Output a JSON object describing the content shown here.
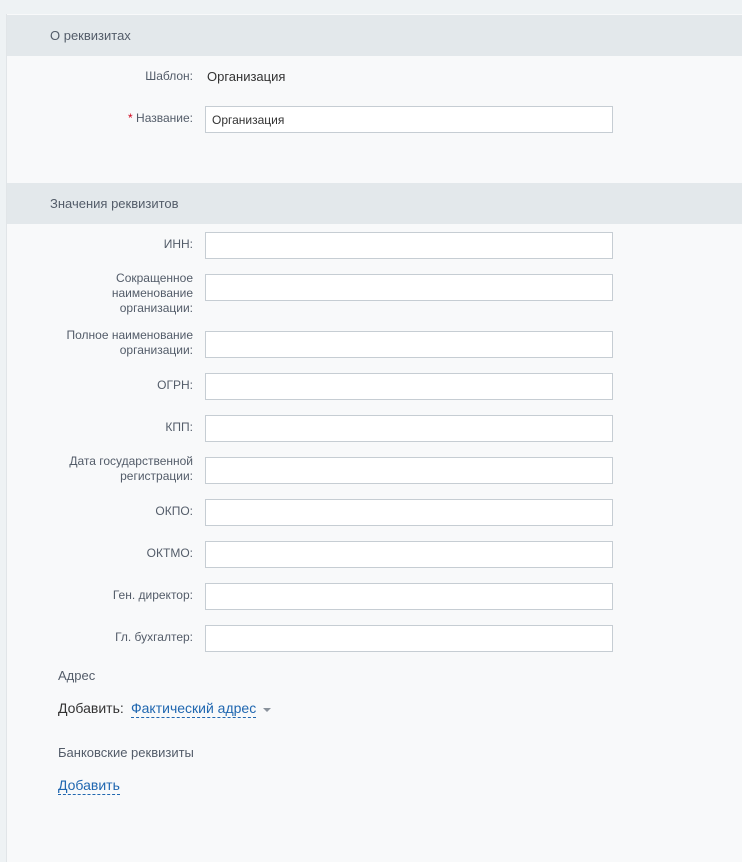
{
  "section_about": {
    "title": "О реквизитах",
    "template_label": "Шаблон:",
    "template_value": "Организация",
    "name_required_mark": "*",
    "name_label": "Название:",
    "name_value": "Организация"
  },
  "section_values": {
    "title": "Значения реквизитов",
    "fields": [
      {
        "label": "ИНН:",
        "value": ""
      },
      {
        "label": "Сокращенное наименование организации:",
        "value": ""
      },
      {
        "label": "Полное наименование организации:",
        "value": ""
      },
      {
        "label": "ОГРН:",
        "value": ""
      },
      {
        "label": "КПП:",
        "value": ""
      },
      {
        "label": "Дата государственной регистрации:",
        "value": ""
      },
      {
        "label": "ОКПО:",
        "value": ""
      },
      {
        "label": "ОКТМО:",
        "value": ""
      },
      {
        "label": "Ген. директор:",
        "value": ""
      },
      {
        "label": "Гл. бухгалтер:",
        "value": ""
      }
    ]
  },
  "address": {
    "title": "Адрес",
    "add_label": "Добавить:",
    "add_link": "Фактический адрес"
  },
  "bank": {
    "title": "Банковские реквизиты",
    "add_link": "Добавить"
  },
  "colors": {
    "link": "#2067b0",
    "required": "#d0021b",
    "header_bg": "#e3e8eb"
  }
}
